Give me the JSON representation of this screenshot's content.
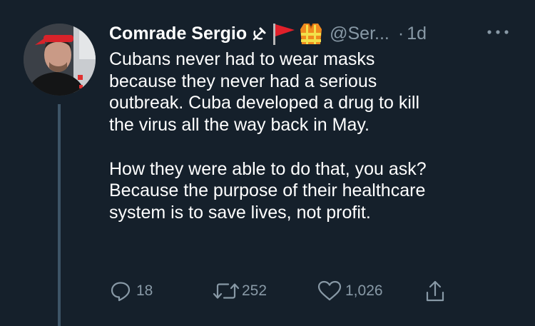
{
  "author": {
    "display_name": "Comrade Sergio",
    "handle": "@Ser...",
    "timestamp": "1d",
    "timestamp_separator": "·",
    "name_emojis": [
      "hammer-sickle-icon",
      "red-flag-icon",
      "safety-vest-icon"
    ]
  },
  "tweet": {
    "paragraphs": [
      "Cubans never had to wear masks\nbecause they never had a serious\noutbreak. Cuba developed a drug to kill\nthe virus all the way back in May.",
      "How they were able to do that, you ask?\nBecause the purpose of their healthcare\nsystem is to save lives, not profit."
    ]
  },
  "stats": {
    "replies": "18",
    "retweets": "252",
    "likes": "1,026"
  },
  "colors": {
    "background": "#15202b",
    "text": "#ffffff",
    "secondary": "#8899a6",
    "thread_line": "#3d5466"
  }
}
